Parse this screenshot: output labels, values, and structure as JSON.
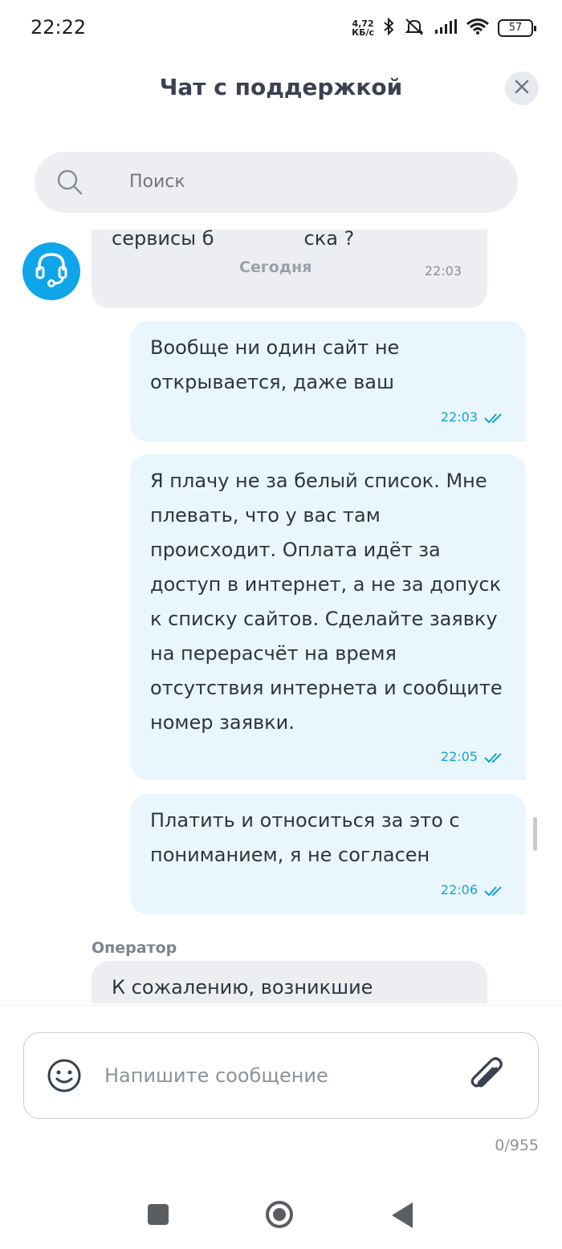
{
  "status_bar": {
    "time": "22:22",
    "net_speed_value": "4,72",
    "net_speed_unit": "КБ/с",
    "battery": "57"
  },
  "header": {
    "title": "Чат с поддержкой"
  },
  "search": {
    "placeholder": "Поиск"
  },
  "chat": {
    "date_divider": "Сегодня",
    "messages": [
      {
        "from": "operator",
        "text": "сервисы б",
        "text_tail": "ска ?",
        "time": "22:03"
      },
      {
        "from": "me",
        "text": "Вообще ни один сайт не открывается, даже ваш",
        "time": "22:03"
      },
      {
        "from": "me",
        "text": "Я плачу не за белый список. Мне плевать, что у вас там происходит. Оплата идёт за доступ в интернет, а не за допуск к списку сайтов. Сделайте заявку на перерасчёт на время отсутствия интернета и сообщите номер заявки.",
        "time": "22:05"
      },
      {
        "from": "me",
        "text": "Платить и относиться за это с пониманием, я не согласен",
        "time": "22:06"
      },
      {
        "from": "operator",
        "sender_label": "Оператор",
        "text": "К сожалению, возникшие"
      }
    ]
  },
  "composer": {
    "placeholder": "Напишите сообщение",
    "counter": "0/955"
  },
  "colors": {
    "accent": "#0fa5e9",
    "my_bubble": "#eaf6fd",
    "operator_bubble": "#eceef2",
    "time_accent": "#10a5d4"
  }
}
